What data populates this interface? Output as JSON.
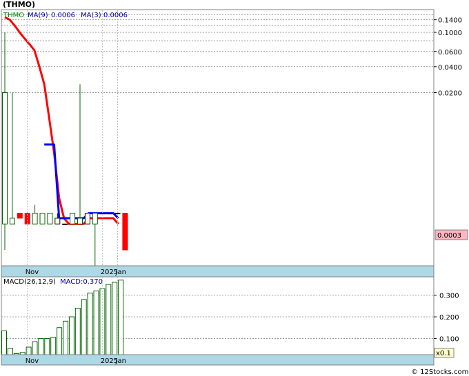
{
  "title": "(THMO)",
  "copyright": "© 12Stocks.com",
  "colors": {
    "ma9": "#ff0000",
    "ma3": "#0000ff",
    "up": "#006400",
    "down": "#ff0000",
    "band": "#add8e6",
    "price_tag_bg": "#ffb6c1"
  },
  "chart_data": [
    {
      "type": "candlestick",
      "scale": "log",
      "legend": {
        "symbol": "THMO",
        "ma9_label": "MA(9)",
        "ma9_value": "0.0006",
        "ma3_label": "MA(3)",
        "ma3_value": "0.0006"
      },
      "ylim": [
        0.0002,
        0.18
      ],
      "yticks": [
        0.14,
        0.1,
        0.06,
        0.04,
        0.02
      ],
      "ytick_labels": [
        "0.1400",
        "0.1000",
        "0.0600",
        "0.0400",
        "0.0200"
      ],
      "extra_gridlines": [
        0.16,
        0.12,
        0.08
      ],
      "current_price": "0.0003",
      "current_price_value": 0.0003,
      "x_labels": [
        {
          "index": 3,
          "text": "Nov"
        },
        {
          "index": 13,
          "text": "2025"
        },
        {
          "index": 15,
          "text": "Jan"
        }
      ],
      "candles": [
        {
          "o": 0.0006,
          "h": 0.1,
          "l": 0.0003,
          "c": 0.02,
          "color": "up"
        },
        {
          "o": 0.0006,
          "h": 0.02,
          "l": 0.0006,
          "c": 0.0007,
          "color": "up"
        },
        {
          "o": 0.0008,
          "h": 0.0008,
          "l": 0.0007,
          "c": 0.0007,
          "color": "down"
        },
        {
          "o": 0.0008,
          "h": 0.0008,
          "l": 0.0006,
          "c": 0.0006,
          "color": "down"
        },
        {
          "o": 0.0006,
          "h": 0.001,
          "l": 0.0006,
          "c": 0.0008,
          "color": "up"
        },
        {
          "o": 0.0006,
          "h": 0.0008,
          "l": 0.0006,
          "c": 0.0008,
          "color": "up"
        },
        {
          "o": 0.0006,
          "h": 0.0008,
          "l": 0.0006,
          "c": 0.0008,
          "color": "up"
        },
        {
          "o": 0.0007,
          "h": 0.0008,
          "l": 0.0006,
          "c": 0.0006,
          "color": "neutral"
        },
        {
          "o": 0.0006,
          "h": 0.0006,
          "l": 0.0006,
          "c": 0.0006,
          "color": "neutral"
        },
        {
          "o": 0.0006,
          "h": 0.0008,
          "l": 0.0006,
          "c": 0.0008,
          "color": "up"
        },
        {
          "o": 0.0006,
          "h": 0.025,
          "l": 0.0006,
          "c": 0.0007,
          "color": "up"
        },
        {
          "o": 0.0008,
          "h": 0.0008,
          "l": 0.0006,
          "c": 0.0006,
          "color": "neutral"
        },
        {
          "o": 0.0006,
          "h": 0.0008,
          "l": 0.00015,
          "c": 0.0008,
          "color": "up"
        },
        {
          "o": 0.0008,
          "h": 0.0008,
          "l": 0.0008,
          "c": 0.0008,
          "color": "neutral"
        },
        {
          "o": 0.0008,
          "h": 0.0008,
          "l": 0.0008,
          "c": 0.0008,
          "color": "neutral"
        },
        {
          "o": 0.0008,
          "h": 0.0008,
          "l": 0.0008,
          "c": 0.0008,
          "color": "neutral"
        },
        {
          "o": 0.0008,
          "h": 0.0008,
          "l": 0.0003,
          "c": 0.0003,
          "color": "down"
        }
      ],
      "ma9": [
        0.15,
        0.14,
        0.12,
        0.1,
        0.085,
        0.073,
        0.062,
        0.04,
        0.025,
        0.01,
        0.004,
        0.0012,
        0.0007,
        0.0006,
        0.0006,
        0.0006,
        0.0006,
        0.0007,
        0.0007,
        0.0007,
        0.0007,
        0.0007,
        0.0007,
        0.0006
      ],
      "ma3": [
        null,
        null,
        null,
        null,
        null,
        null,
        null,
        null,
        0.005,
        0.005,
        0.005,
        0.0007,
        0.0007,
        0.0007,
        0.0007,
        0.0007,
        0.0007,
        0.0008,
        0.0008,
        0.0008,
        0.0008,
        0.0008,
        0.0008,
        0.0007
      ]
    },
    {
      "type": "bar",
      "title": "MACD(26,12,9)",
      "value_label": "MACD:0.370",
      "ylim": [
        0.025,
        0.385
      ],
      "yticks": [
        0.3,
        0.2,
        0.1
      ],
      "ytick_labels": [
        "0.300",
        "0.200",
        "0.100"
      ],
      "scale_label": "x0.1",
      "x_labels": [
        {
          "index": 3,
          "text": "Nov"
        },
        {
          "index": 13,
          "text": "2025"
        },
        {
          "index": 15,
          "text": "Jan"
        }
      ],
      "values": [
        0.135,
        0.055,
        0.03,
        0.035,
        0.06,
        0.085,
        0.1,
        0.1,
        0.105,
        0.15,
        0.18,
        0.2,
        0.24,
        0.28,
        0.31,
        0.32,
        0.33,
        0.35,
        0.36,
        0.37
      ]
    }
  ]
}
